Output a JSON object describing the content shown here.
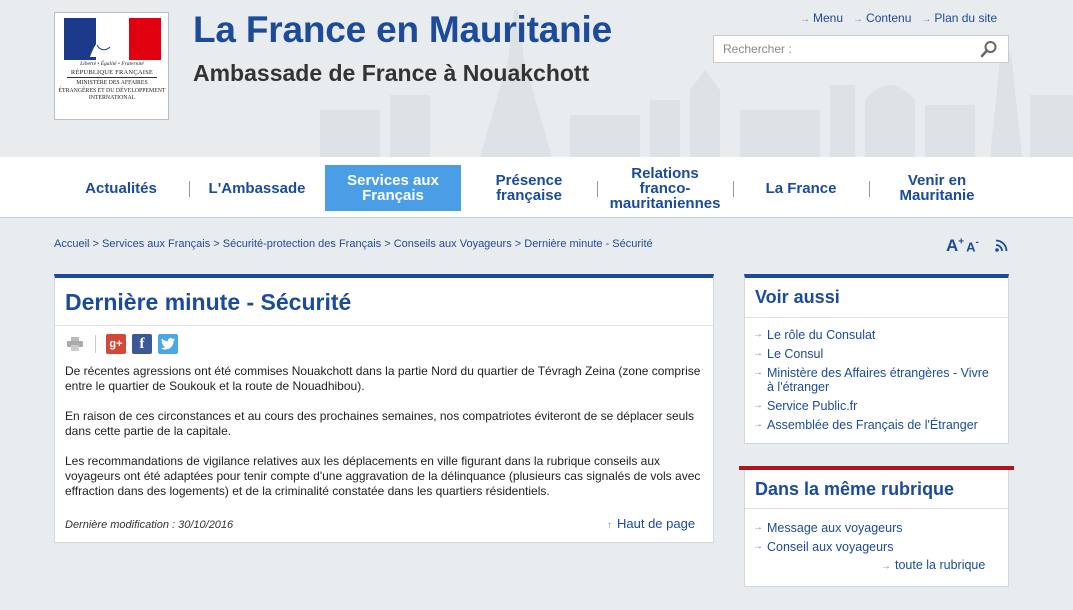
{
  "colors": {
    "brand_blue": "#1b4b9a",
    "active_nav": "#4a9ee6",
    "accent_red": "#b0141c"
  },
  "logo": {
    "motto": "Liberté • Égalité • Fraternité",
    "republic": "RÉPUBLIQUE FRANÇAISE",
    "ministry": "MINISTÈRE DES AFFAIRES ÉTRANGÈRES ET DU DÉVELOPPEMENT INTERNATIONAL"
  },
  "header": {
    "title": "La France en Mauritanie",
    "subtitle": "Ambassade de France à Nouakchott"
  },
  "toplinks": [
    "Menu",
    "Contenu",
    "Plan du site"
  ],
  "search": {
    "placeholder": "Rechercher :"
  },
  "nav": {
    "active_index": 2,
    "items": [
      {
        "label": "Actualités"
      },
      {
        "label": "L'Ambassade"
      },
      {
        "label": "Services aux Français"
      },
      {
        "label": "Présence française"
      },
      {
        "label": "Relations franco-mauritaniennes"
      },
      {
        "label": "La France"
      },
      {
        "label": "Venir en Mauritanie"
      }
    ]
  },
  "breadcrumb": [
    "Accueil",
    "Services aux Français",
    "Sécurité-protection des Français",
    "Conseils aux Voyageurs",
    "Dernière minute - Sécurité"
  ],
  "tools": {
    "font_up": "A",
    "font_up_sign": "+",
    "font_down": "A",
    "font_down_sign": "-"
  },
  "article": {
    "title": "Dernière minute - Sécurité",
    "paragraphs": [
      "De récentes agressions ont été commises Nouakchott dans la partie Nord du quartier de Tévragh Zeina (zone comprise entre le quartier de Soukouk et la route de Nouadhibou).",
      "En raison de ces circonstances et au cours des prochaines semaines, nos compatriotes éviteront de se déplacer seuls dans cette partie de la capitale.",
      "Les recommandations de vigilance relatives aux les déplacements en ville figurant dans la rubrique conseils aux voyageurs ont été adaptées pour tenir compte d'une aggravation de la délinquance (plusieurs cas signalés de vols avec effraction dans des logements) et de la criminalité constatée dans les quartiers résidentiels."
    ],
    "last_modified": "Dernière modification : 30/10/2016",
    "back_to_top": "Haut de page"
  },
  "voir_aussi": {
    "title": "Voir aussi",
    "links": [
      "Le rôle du Consulat",
      "Le Consul",
      "Ministère des Affaires étrangères - Vivre à l'étranger",
      "Service Public.fr",
      "Assemblée des Français de l'Étranger"
    ]
  },
  "meme_rubrique": {
    "title": "Dans la même rubrique",
    "links": [
      "Message aux voyageurs",
      "Conseil aux voyageurs"
    ],
    "all_link": "toute la rubrique"
  }
}
